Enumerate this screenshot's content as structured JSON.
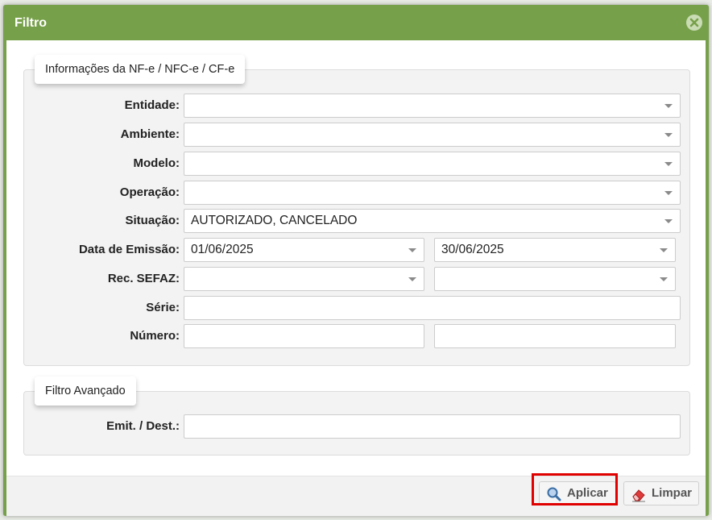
{
  "dialog": {
    "title": "Filtro",
    "close_icon": "close-circle-icon"
  },
  "nfe_section": {
    "legend": "Informações da NF-e / NFC-e / CF-e",
    "fields": {
      "entidade": {
        "label": "Entidade:",
        "value": ""
      },
      "ambiente": {
        "label": "Ambiente:",
        "value": ""
      },
      "modelo": {
        "label": "Modelo:",
        "value": ""
      },
      "operacao": {
        "label": "Operação:",
        "value": ""
      },
      "situacao": {
        "label": "Situação:",
        "value": "AUTORIZADO, CANCELADO"
      },
      "data_emissao": {
        "label": "Data de Emissão:",
        "start": "01/06/2025",
        "end": "30/06/2025"
      },
      "rec_sefaz": {
        "label": "Rec. SEFAZ:",
        "start": "",
        "end": ""
      },
      "serie": {
        "label": "Série:",
        "value": ""
      },
      "numero": {
        "label": "Número:",
        "start": "",
        "end": ""
      }
    }
  },
  "advanced_section": {
    "legend": "Filtro Avançado",
    "fields": {
      "emit_dest": {
        "label": "Emit. / Dest.:",
        "value": ""
      }
    }
  },
  "footer": {
    "apply_label": "Aplicar",
    "apply_icon": "magnifier-icon",
    "clear_label": "Limpar",
    "clear_icon": "eraser-icon",
    "highlight_color": "#e00000"
  },
  "colors": {
    "accent": "#77a04a"
  }
}
